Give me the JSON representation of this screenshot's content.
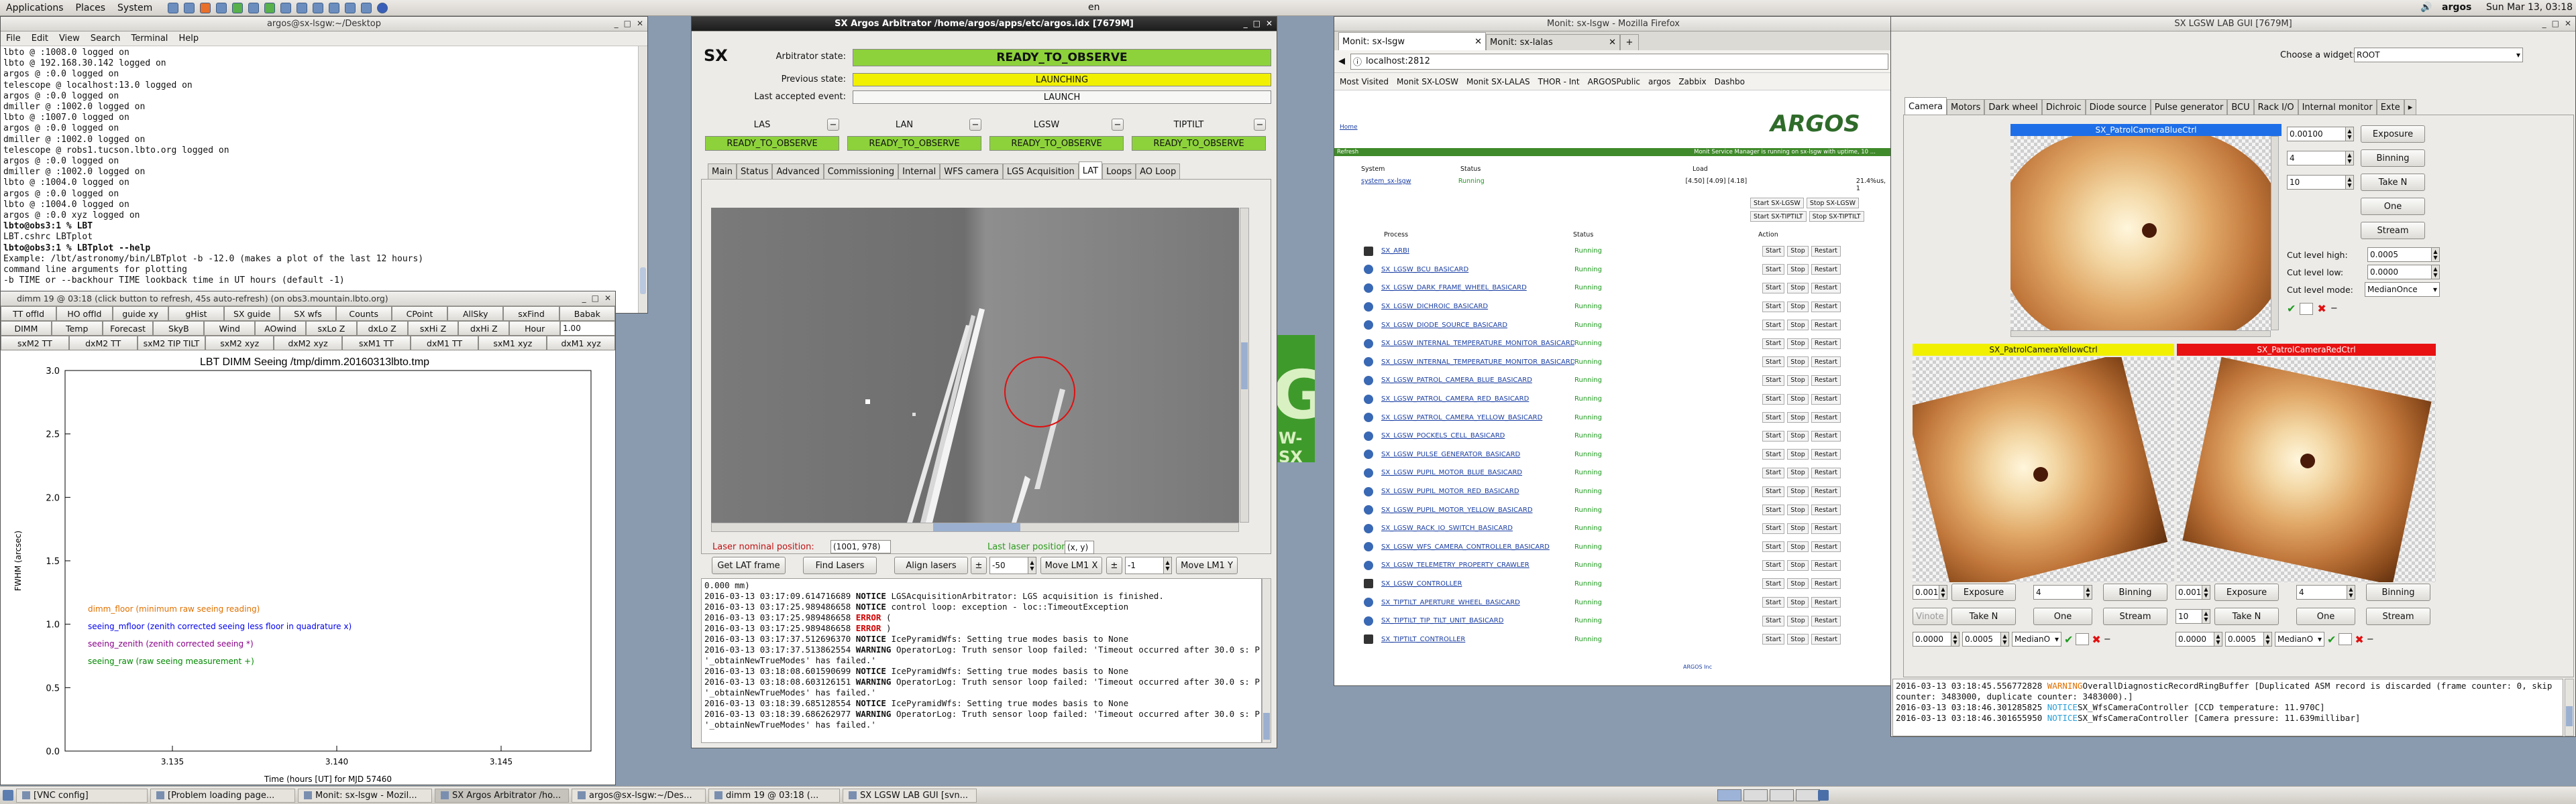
{
  "top_panel": {
    "menus": [
      "Applications",
      "Places",
      "System"
    ],
    "keyboard": "en",
    "user": "argos",
    "datetime": "Sun Mar 13, 03:18"
  },
  "terminal": {
    "title": "argos@sx-lsgw:~/Desktop",
    "menus": [
      "File",
      "Edit",
      "View",
      "Search",
      "Terminal",
      "Help"
    ],
    "lines": [
      "lbto @ :1008.0 logged on",
      "lbto @ 192.168.30.142 logged on",
      "argos @ :0.0 logged on",
      "telescope @ localhost:13.0 logged on",
      "argos @ :0.0 logged on",
      "dmiller @ :1002.0 logged on",
      "lbto @ :1007.0 logged on",
      "argos @ :0.0 logged on",
      "dmiller @ :1002.0 logged on",
      "telescope @ robs1.tucson.lbto.org logged on",
      "argos @ :0.0 logged on",
      "dmiller @ :1002.0 logged on",
      "lbto @ :1004.0 logged on",
      "argos @ :0.0 logged on",
      "lbto @ :1004.0 logged on",
      "argos @ :0.0 xyz logged on",
      "lbto@obs3:1 % LBT",
      "LBT.cshrc LBTplot",
      "lbto@obs3:1 % LBTplot --help",
      "Example:  /lbt/astronomy/bin/LBTplot  -b -12.0   (makes a plot of the last 12 hours)",
      "command line arguments for plotting",
      "-b TIME or --backhour TIME  lookback time in UT hours (default -1)"
    ]
  },
  "dimm": {
    "title": "dimm 19  @ 03:18     (click button to refresh, 45s auto-refresh)  (on obs3.mountain.lbto.org)",
    "row1": [
      "TT offId",
      "HO offId",
      "guide xy",
      "gHist",
      "SX guide",
      "SX wfs",
      "Counts",
      "CPoint",
      "AllSky",
      "sxFind",
      "Babak"
    ],
    "row2": [
      "DIMM",
      "Temp",
      "Forecast",
      "SkyB",
      "Wind",
      "AOwind",
      "sxLo Z",
      "dxLo Z",
      "sxHi Z",
      "dxHi Z",
      "Hour",
      "1.00"
    ],
    "row3": [
      "sxM2 TT",
      "dxM2 TT",
      "sxM2 TIP TILT",
      "sxM2 xyz",
      "dxM2 xyz",
      "sxM1 TT",
      "dxM1 TT",
      "sxM1 xyz",
      "dxM1 xyz"
    ],
    "plot_title": "LBT DIMM Seeing  /tmp/dimm.20160313lbto.tmp",
    "ylabel": "FWHM (arcsec)",
    "xlabel": "Time (hours [UT] for MJD    57460",
    "yticks": [
      "3.0",
      "2.5",
      "2.0",
      "1.5",
      "1.0",
      "0.5",
      "0.0"
    ],
    "xticks": [
      "3.135",
      "3.140",
      "3.145"
    ],
    "legend": [
      {
        "text": "dimm_floor  (minimum raw seeing reading)",
        "color": "#e07000"
      },
      {
        "text": "seeing_mfloor (zenith corrected seeing less floor in quadrature x)",
        "color": "#0000ee"
      },
      {
        "text": "seeing_zenith (zenith corrected seeing *)",
        "color": "#880088"
      },
      {
        "text": "seeing_raw (raw seeing measurement +)",
        "color": "#008800"
      }
    ]
  },
  "arbitrator": {
    "title": "SX Argos Arbitrator /home/argos/apps/etc/argos.idx [7679M]",
    "sx": "SX",
    "arb_state_label": "Arbitrator state:",
    "arb_state": "READY_TO_OBSERVE",
    "prev_state_label": "Previous state:",
    "prev_state": "LAUNCHING",
    "last_event_label": "Last accepted event:",
    "last_event": "LAUNCH",
    "subsystems": [
      {
        "name": "LAS",
        "state": "READY_TO_OBSERVE"
      },
      {
        "name": "LAN",
        "state": "READY_TO_OBSERVE"
      },
      {
        "name": "LGSW",
        "state": "READY_TO_OBSERVE"
      },
      {
        "name": "TIPTILT",
        "state": "READY_TO_OBSERVE"
      }
    ],
    "tabs": [
      "Main",
      "Status",
      "Advanced",
      "Commissioning",
      "Internal",
      "WFS camera",
      "LGS Acquisition",
      "LAT",
      "Loops",
      "AO Loop"
    ],
    "selected_tab": "LAT",
    "laser_nominal_label": "Laser nominal position:",
    "laser_nominal": "(1001, 978)",
    "last_laser_label": "Last laser position:",
    "last_laser": "(x, y)",
    "buttons": [
      "Get LAT frame",
      "Find Lasers",
      "Align lasers"
    ],
    "pm1": "±",
    "val1": "-50",
    "move_lm1x": "Move LM1 X",
    "pm2": "±",
    "val2": "-1",
    "move_lm1y": "Move LM1 Y",
    "log": [
      {
        "t": "0.000 mm)",
        "k": ""
      },
      {
        "t": "2016-03-13 03:17:09.614716689 ",
        "k": "NOTICE",
        "m": " LGSAcquisitionArbitrator: LGS acquisition is finished."
      },
      {
        "t": "2016-03-13 03:17:25.989486658 ",
        "k": "NOTICE",
        "m": " control loop: exception - loc::TimeoutException"
      },
      {
        "t": "2016-03-13 03:17:25.989486658 ",
        "k": "ERROR",
        "m": " ("
      },
      {
        "t": "2016-03-13 03:17:25.989486658 ",
        "k": "ERROR",
        "m": " )"
      },
      {
        "t": "2016-03-13 03:17:37.512696370 ",
        "k": "NOTICE",
        "m": " IcePyramidWfs: Setting true modes basis to None"
      },
      {
        "t": "2016-03-13 03:17:37.513862554 ",
        "k": "WARNING",
        "m": " OperatorLog: Truth sensor loop failed: 'Timeout occurred after 30.0 s: Predicate"
      },
      {
        "t": "'_obtainNewTrueModes' has failed.'",
        "k": ""
      },
      {
        "t": "2016-03-13 03:18:08.601590699 ",
        "k": "NOTICE",
        "m": " IcePyramidWfs: Setting true modes basis to None"
      },
      {
        "t": "2016-03-13 03:18:08.603126151 ",
        "k": "WARNING",
        "m": " OperatorLog: Truth sensor loop failed: 'Timeout occurred after 30.0 s: Predicate"
      },
      {
        "t": "'_obtainNewTrueModes' has failed.'",
        "k": ""
      },
      {
        "t": "2016-03-13 03:18:39.685128554 ",
        "k": "NOTICE",
        "m": " IcePyramidWfs: Setting true modes basis to None"
      },
      {
        "t": "2016-03-13 03:18:39.686262977 ",
        "k": "WARNING",
        "m": " OperatorLog: Truth sensor loop failed: 'Timeout occurred after 30.0 s: Predicate"
      },
      {
        "t": "'_obtainNewTrueModes' has failed.'",
        "k": ""
      }
    ]
  },
  "firefox": {
    "title": "Monit: sx-lsgw - Mozilla Firefox",
    "tabs": [
      "Monit: sx-lsgw",
      "Monit: sx-lalas"
    ],
    "url": "localhost:2812",
    "bookmarks": [
      "Most Visited",
      "Monit SX-LOSW",
      "Monit SX-LALAS",
      "THOR - Int",
      "ARGOSPublic",
      "argos",
      "Zabbix",
      "Dashbo"
    ],
    "logo": "ARGOS",
    "home": "Home",
    "banner": "Monit Service Manager is running on sx-lsgw with uptime, 10 ...",
    "refresh": "Refresh",
    "sys_headers": [
      "System",
      "Status",
      "Load"
    ],
    "sys_row": [
      "system_sx-lsgw",
      "Running",
      "[4.50] [4.09] [4.18]"
    ],
    "sys_extra": "21.4%us, 1",
    "start_stop": [
      "Start SX-LGSW",
      "Stop SX-LGSW",
      "Start SX-TIPTILT",
      "Stop SX-TIPTILT"
    ],
    "proc_headers": [
      "Process",
      "Status",
      "Action"
    ],
    "processes": [
      "SX_ARBI",
      "SX_LGSW_BCU_BASICARD",
      "SX_LGSW_DARK_FRAME_WHEEL_BASICARD",
      "SX_LGSW_DICHROIC_BASICARD",
      "SX_LGSW_DIODE_SOURCE_BASICARD",
      "SX_LGSW_INTERNAL_TEMPERATURE_MONITOR_BASICARD",
      "SX_LGSW_INTERNAL_TEMPERATURE_MONITOR_BASICARD",
      "SX_LGSW_PATROL_CAMERA_BLUE_BASICARD",
      "SX_LGSW_PATROL_CAMERA_RED_BASICARD",
      "SX_LGSW_PATROL_CAMERA_YELLOW_BASICARD",
      "SX_LGSW_POCKELS_CELL_BASICARD",
      "SX_LGSW_PULSE_GENERATOR_BASICARD",
      "SX_LGSW_PUPIL_MOTOR_BLUE_BASICARD",
      "SX_LGSW_PUPIL_MOTOR_RED_BASICARD",
      "SX_LGSW_PUPIL_MOTOR_YELLOW_BASICARD",
      "SX_LGSW_RACK_IO_SWITCH_BASICARD",
      "SX_LGSW_WFS_CAMERA_CONTROLLER_BASICARD",
      "SX_LGSW_TELEMETRY_PROPERTY_CRAWLER",
      "SX_LGSW_CONTROLLER",
      "SX_TIPTILT_APERTURE_WHEEL_BASICARD",
      "SX_TIPTILT_TIP_TILT_UNIT_BASICARD",
      "SX_TIPTILT_CONTROLLER"
    ],
    "proc_status": "Running",
    "actions": [
      "Start",
      "Stop",
      "Restart"
    ],
    "footer": "ARGOS Inc"
  },
  "labgui": {
    "title": "SX LGSW LAB GUI [7679M]",
    "choose_label": "Choose a widget:",
    "choose_value": "ROOT",
    "tabs": [
      "Camera",
      "Motors",
      "Dark wheel",
      "Dichroic",
      "Diode source",
      "Pulse generator",
      "BCU",
      "Rack I/O",
      "Internal monitor",
      "Exte"
    ],
    "blue_cam": "SX_PatrolCameraBlueCtrl",
    "yellow_cam": "SX_PatrolCameraYellowCtrl",
    "red_cam": "SX_PatrolCameraRedCtrl",
    "exp_val": "0.00100",
    "exposure": "Exposure",
    "bin_val": "4",
    "binning": "Binning",
    "n_val": "10",
    "take_n": "Take N",
    "one": "One",
    "stream": "Stream",
    "cut_high_label": "Cut level high:",
    "cut_high": "0.0005",
    "cut_low_label": "Cut level low:",
    "cut_low": "0.0000",
    "cut_mode_label": "Cut level mode:",
    "cut_mode": "MedianOnce",
    "y_exp": "0.001",
    "y_bin": "4",
    "y_n": "10",
    "y_c1": "0.0000",
    "y_c2": "0.0005",
    "y_mode": "MedianO",
    "r_exp": "0.001",
    "r_bin": "4",
    "r_n": "10",
    "r_c1": "0.0000",
    "r_c2": "0.0005",
    "r_mode": "MedianO",
    "vinote": "Vinote",
    "log": [
      {
        "t": "2016-03-13 03:18:45.556772828 ",
        "k": "WARNING",
        "m": "OverallDiagnosticRecordRingBuffer [Duplicated ASM record is discarded (frame counter: 0, skip counter: 3483000, duplicate counter: 3483000).]"
      },
      {
        "t": "2016-03-13 03:18:46.301285825 ",
        "k": "NOTICE",
        "m": "SX_WfsCameraController [CCD temperature: 11.970C]"
      },
      {
        "t": "2016-03-13 03:18:46.301655950 ",
        "k": "NOTICE",
        "m": "SX_WfsCameraController [Camera pressure: 11.639millibar]"
      }
    ]
  },
  "taskbar": [
    "[VNC config]",
    "[Problem loading page...",
    "Monit: sx-lsgw - Mozil...",
    "SX Argos Arbitrator /ho...",
    "argos@sx-lsgw:~/Des...",
    "dimm 19  @ 03:18    (...",
    "SX LGSW LAB GUI [svn..."
  ]
}
